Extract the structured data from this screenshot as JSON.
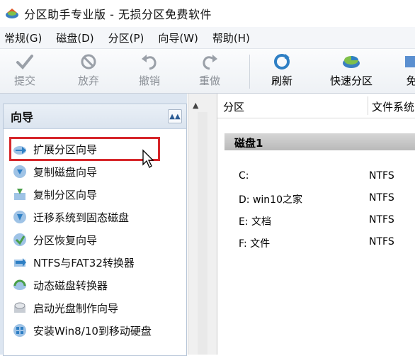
{
  "window": {
    "title": "分区助手专业版 - 无损分区免费软件"
  },
  "menu": [
    "常规(G)",
    "磁盘(D)",
    "分区(P)",
    "向导(W)",
    "帮助(H)"
  ],
  "toolbar": {
    "buttons": [
      {
        "label": "提交",
        "icon": "check-icon",
        "enabled": false
      },
      {
        "label": "放弃",
        "icon": "discard-icon",
        "enabled": false
      },
      {
        "label": "撤销",
        "icon": "undo-icon",
        "enabled": false
      },
      {
        "label": "重做",
        "icon": "redo-icon",
        "enabled": false
      },
      {
        "label": "刷新",
        "icon": "refresh-icon",
        "enabled": true
      },
      {
        "label": "快速分区",
        "icon": "quick-partition-icon",
        "enabled": true
      },
      {
        "label": "免",
        "icon": "more-icon",
        "enabled": true
      }
    ]
  },
  "wizard": {
    "title": "向导",
    "collapse_icon": "collapse-up-icon",
    "items": [
      {
        "label": "扩展分区向导",
        "icon": "extend-partition-icon",
        "highlighted": true
      },
      {
        "label": "复制磁盘向导",
        "icon": "copy-disk-icon"
      },
      {
        "label": "复制分区向导",
        "icon": "copy-partition-icon"
      },
      {
        "label": "迁移系统到固态磁盘",
        "icon": "migrate-os-icon"
      },
      {
        "label": "分区恢复向导",
        "icon": "partition-recovery-icon"
      },
      {
        "label": "NTFS与FAT32转换器",
        "icon": "ntfs-fat32-icon"
      },
      {
        "label": "动态磁盘转换器",
        "icon": "dynamic-disk-icon"
      },
      {
        "label": "启动光盘制作向导",
        "icon": "boot-cd-icon"
      },
      {
        "label": "安装Win8/10到移动硬盘",
        "icon": "install-windows-icon"
      }
    ]
  },
  "partitions": {
    "columns": [
      "分区",
      "文件系统"
    ],
    "disk_label": "磁盘1",
    "rows": [
      {
        "name": "C:",
        "fs": "NTFS"
      },
      {
        "name": "D: win10之家",
        "fs": "NTFS"
      },
      {
        "name": "E: 文档",
        "fs": "NTFS"
      },
      {
        "name": "F: 文件",
        "fs": "NTFS"
      }
    ]
  },
  "colors": {
    "highlight": "#d6262a",
    "panel_bg": "#dde6f1",
    "accent": "#2e7fc4"
  }
}
